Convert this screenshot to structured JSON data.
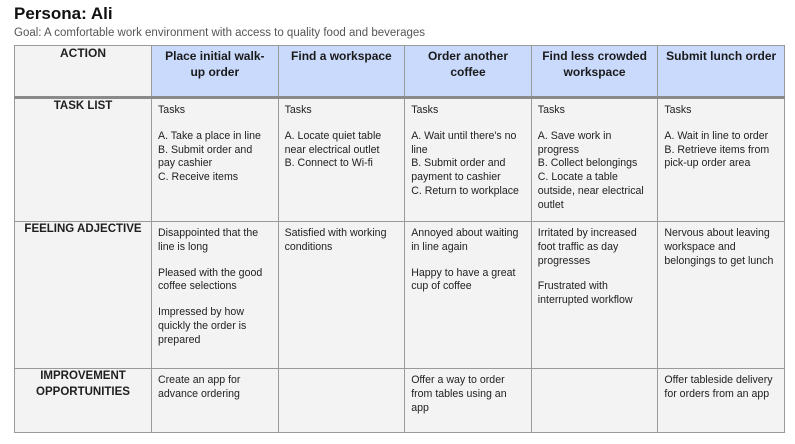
{
  "persona_title": "Persona: Ali",
  "goal": "Goal: A comfortable work environment with access to quality food and beverages",
  "table": {
    "corner_label": "ACTION",
    "steps": [
      "Place initial walk-up order",
      "Find a workspace",
      "Order another coffee",
      "Find less crowded workspace",
      "Submit lunch order"
    ],
    "rows": [
      {
        "label": "TASK LIST",
        "cells": [
          [
            "Tasks",
            "A. Take a place in line\nB. Submit order and pay cashier\nC. Receive items"
          ],
          [
            "Tasks",
            "A. Locate quiet table near electrical outlet\nB. Connect to Wi-fi"
          ],
          [
            "Tasks",
            "A. Wait until there's no line\nB. Submit order and payment to cashier\nC. Return to workplace"
          ],
          [
            "Tasks",
            "A. Save work in progress\nB. Collect belongings\nC. Locate a table outside, near electrical outlet"
          ],
          [
            "Tasks",
            "A. Wait in line to order\nB. Retrieve items from pick-up order area"
          ]
        ]
      },
      {
        "label": "FEELING ADJECTIVE",
        "cells": [
          [
            "Disappointed that the line is long",
            "Pleased with the good coffee selections",
            "Impressed by how quickly the order is prepared"
          ],
          [
            "Satisfied with working conditions"
          ],
          [
            "Annoyed about waiting in line again",
            "Happy to have a great cup of coffee"
          ],
          [
            "Irritated by increased foot traffic as day progresses",
            "Frustrated with interrupted workflow"
          ],
          [
            "Nervous about leaving workspace and belongings to get lunch"
          ]
        ]
      },
      {
        "label": "IMPROVEMENT OPPORTUNITIES",
        "cells": [
          [
            "Create an app for advance ordering"
          ],
          [],
          [
            "Offer a way to order from tables using an app"
          ],
          [],
          [
            "Offer tableside delivery for orders from an app"
          ]
        ]
      }
    ]
  }
}
